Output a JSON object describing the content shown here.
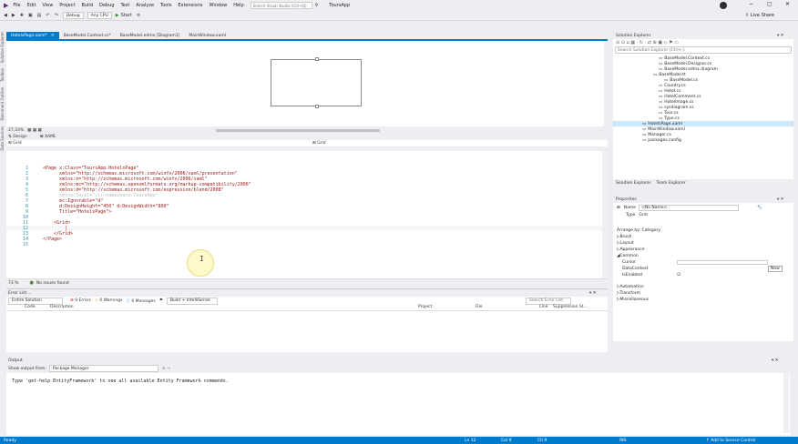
{
  "menu": {
    "items": [
      "File",
      "Edit",
      "View",
      "Project",
      "Build",
      "Debug",
      "Test",
      "Analyze",
      "Tools",
      "Extensions",
      "Window",
      "Help"
    ],
    "search_placeholder": "Search Visual Studio (Ctrl+Q)",
    "solution_name": "ToursApp",
    "live_share": "Live Share"
  },
  "toolbar": {
    "config": "Debug",
    "platform": "Any CPU",
    "start": "Start"
  },
  "left_strip": [
    "Solution Explorer",
    "Toolbox",
    "Document Outline",
    "Data Sources"
  ],
  "tabs": [
    {
      "label": "HotelsPage.xaml*"
    },
    {
      "label": "BaseModel.Context.cs*"
    },
    {
      "label": "BaseModel.edmx [Diagram1]"
    },
    {
      "label": "MainWindow.xaml"
    }
  ],
  "designer": {
    "zoom": "27,33%",
    "design_tab": "Design",
    "xaml_tab": "XAML",
    "grid_left": "Grid",
    "grid_right": "Grid"
  },
  "code_lines": [
    [
      "1",
      "<Page x:Class=\"ToursApp.HotelsPage\""
    ],
    [
      "2",
      "      xmlns=\"http://schemas.microsoft.com/winfx/2006/xaml/presentation\""
    ],
    [
      "3",
      "      xmlns:x=\"http://schemas.microsoft.com/winfx/2006/xaml\""
    ],
    [
      "4",
      "      xmlns:mc=\"http://schemas.openxmlformats.org/markup-compatibility/2006\""
    ],
    [
      "5",
      "      xmlns:d=\"http://schemas.microsoft.com/expression/blend/2008\""
    ],
    [
      "6",
      "      xmlns:local=\"clr-namespace:ToursApp\""
    ],
    [
      "7",
      "      mc:Ignorable=\"d\""
    ],
    [
      "8",
      "      d:DesignHeight=\"450\" d:DesignWidth=\"800\""
    ],
    [
      "9",
      "      Title=\"HotelsPage\">"
    ],
    [
      "10",
      ""
    ],
    [
      "11",
      "    <Grid>"
    ],
    [
      "12",
      "        |"
    ],
    [
      "13",
      "    </Grid>"
    ],
    [
      "14",
      "</Page>"
    ],
    [
      "15",
      ""
    ]
  ],
  "editor_status": {
    "zoom": "73 %",
    "issues": "No issues found"
  },
  "error_list": {
    "title": "Error List ...",
    "scope": "Entire Solution",
    "errors": "0 Errors",
    "warnings": "0 Warnings",
    "messages": "0 Messages",
    "build": "Build + IntelliSense",
    "search": "Search Error List",
    "columns": [
      "Code",
      "Description",
      "Project",
      "File",
      "Line",
      "Suppression St..."
    ]
  },
  "output": {
    "title": "Output",
    "show_from_label": "Show output from:",
    "source": "Package Manager",
    "text": "Type 'get-help EntityFramework' to see all available Entity Framework commands."
  },
  "solution_explorer": {
    "title": "Solution Explorer",
    "search": "Search Solution Explorer (Ctrl+;)",
    "items": [
      "BaseModel.Context.cs",
      "BaseModel.Designer.cs",
      "BaseModel.edmx.diagram",
      "BaseModel.tt",
      "BaseModel.cs",
      "Country.cs",
      "Hotel.cs",
      "HotelComment.cs",
      "HotelImage.cs",
      "sysdiagram.cs",
      "Tour.cs",
      "Type.cs",
      "HotelsPage.xaml",
      "MainWindow.xaml",
      "Manager.cs",
      "packages.config"
    ],
    "tab1": "Solution Explorer",
    "tab2": "Team Explorer"
  },
  "properties": {
    "title": "Properties",
    "name_label": "Name",
    "name_value": "<No Name>",
    "type_label": "Type",
    "type_value": "Grid",
    "arrange": "Arrange by: Category",
    "categories": [
      "Brush",
      "Layout",
      "Appearance",
      "Common",
      "Cursor",
      "DataContext",
      "IsEnabled",
      "Automation",
      "Transform",
      "Miscellaneous"
    ],
    "new_btn": "New"
  },
  "statusbar": {
    "ready": "Ready",
    "ln": "Ln 12",
    "col": "Col 9",
    "ch": "Ch 9",
    "ins": "INS",
    "source_control": "Add to Source Control"
  }
}
